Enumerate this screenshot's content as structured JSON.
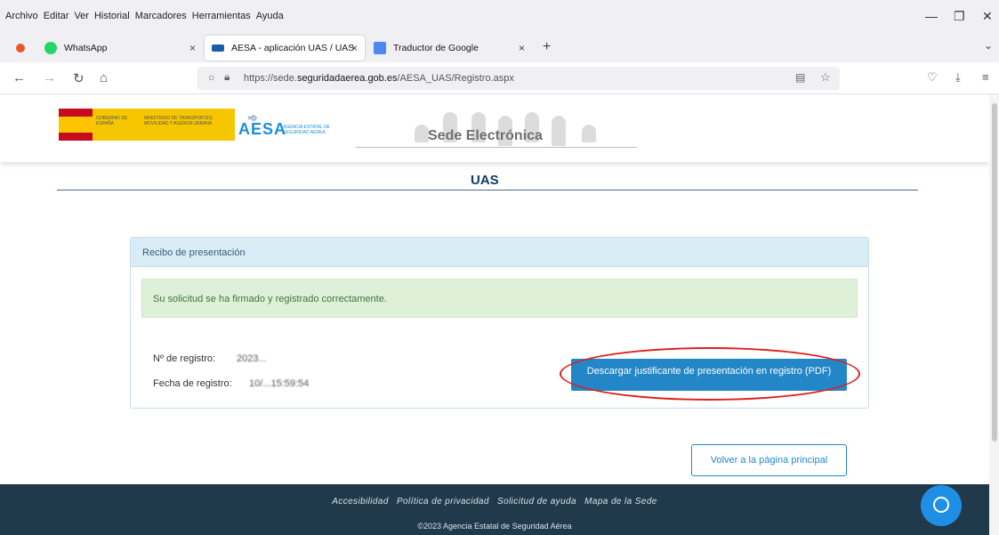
{
  "browser": {
    "menu": [
      "Archivo",
      "Editar",
      "Ver",
      "Historial",
      "Marcadores",
      "Herramientas",
      "Ayuda"
    ],
    "tabs": [
      {
        "label": "WhatsApp",
        "close": "×"
      },
      {
        "label": "AESA - aplicación UAS / UAS w",
        "close": "×"
      },
      {
        "label": "Traductor de Google",
        "close": "×"
      }
    ],
    "new_tab": "+",
    "url_prefix": "https://sede.",
    "url_domain": "seguridadaerea.gob.es",
    "url_path": "/AESA_UAS/Registro.aspx"
  },
  "header": {
    "gov_text_1": "GOBIERNO DE ESPAÑA",
    "gov_text_2": "MINISTERIO DE TRANSPORTES, MOVILIDAD Y AGENDA URBANA",
    "aesa_logo": "AESA",
    "aesa_sub": "AGENCIA ESTATAL DE SEGURIDAD AÉREA",
    "sede_label": "Sede Electrónica"
  },
  "main": {
    "title": "UAS",
    "panel_title": "Recibo de presentación",
    "success_message": "Su solicitud se ha firmado y registrado correctamente.",
    "registro_label": "Nº de registro:",
    "registro_value": "2023...",
    "fecha_label": "Fecha de registro:",
    "fecha_value": "10/...15:59:54",
    "download_button": "Descargar justificante de presentación en registro (PDF)",
    "back_button": "Volver a la página principal"
  },
  "footer": {
    "links": [
      "Accesibilidad",
      "Política de privacidad",
      "Solicitud de ayuda",
      "Mapa de la Sede"
    ],
    "copyright": "©2023 Agencia Estatal de Seguridad Aérea"
  },
  "colors": {
    "accent": "#2387c7",
    "footer_bg": "#203a4c",
    "success_bg": "#dff0d8",
    "annotation": "#e01e1e"
  }
}
